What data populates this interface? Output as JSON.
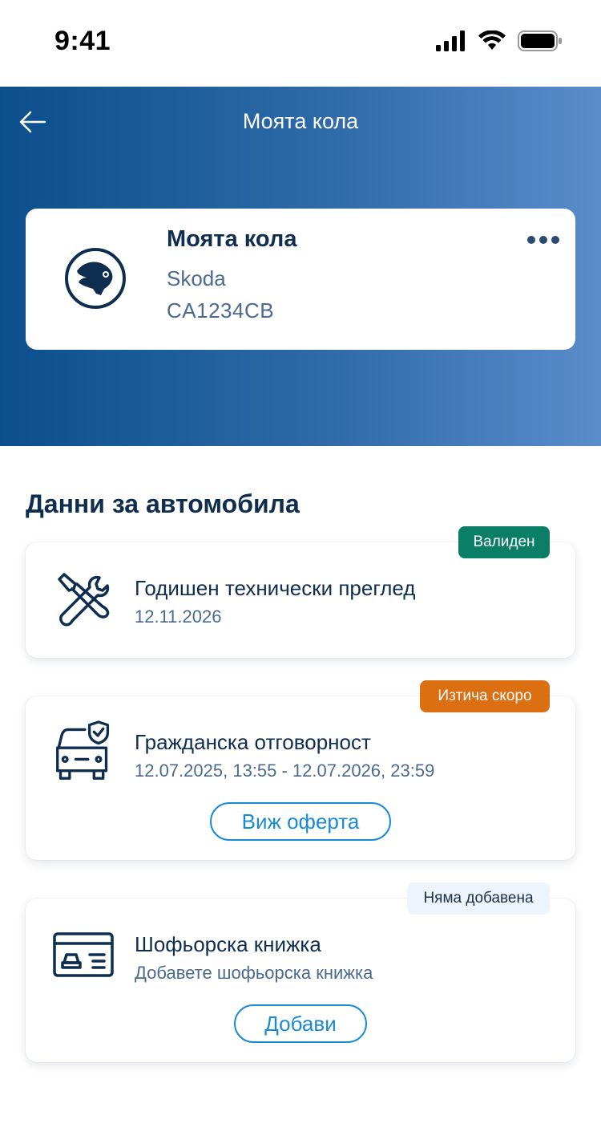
{
  "status_bar": {
    "time": "9:41"
  },
  "header": {
    "title": "Моята кола"
  },
  "car": {
    "name": "Моята кола",
    "brand": "Skoda",
    "plate": "CA1234CB"
  },
  "section": {
    "title": "Данни за автомобила"
  },
  "cards": [
    {
      "title": "Годишен технически преглед",
      "subtitle": "12.11.2026",
      "badge": "Валиден",
      "badge_color": "#0b7f66",
      "icon": "tools-icon"
    },
    {
      "title": "Гражданска отговорност",
      "subtitle": "12.07.2025, 13:55 - 12.07.2026, 23:59",
      "badge": "Изтича скоро",
      "badge_color": "#dc6f12",
      "button": "Виж оферта",
      "icon": "car-shield-icon"
    },
    {
      "title": "Шофьорска книжка",
      "subtitle": "Добавете шофьорска книжка",
      "badge": "Няма добавена",
      "badge_color": "#eef4fb",
      "button": "Добави",
      "icon": "license-card-icon"
    }
  ],
  "colors": {
    "accent": "#1a8ad6",
    "primary_text": "#0f2d4f",
    "secondary_text": "#4b6a8f",
    "hero_start": "#0b4f8c",
    "hero_end": "#5b8ccc"
  }
}
